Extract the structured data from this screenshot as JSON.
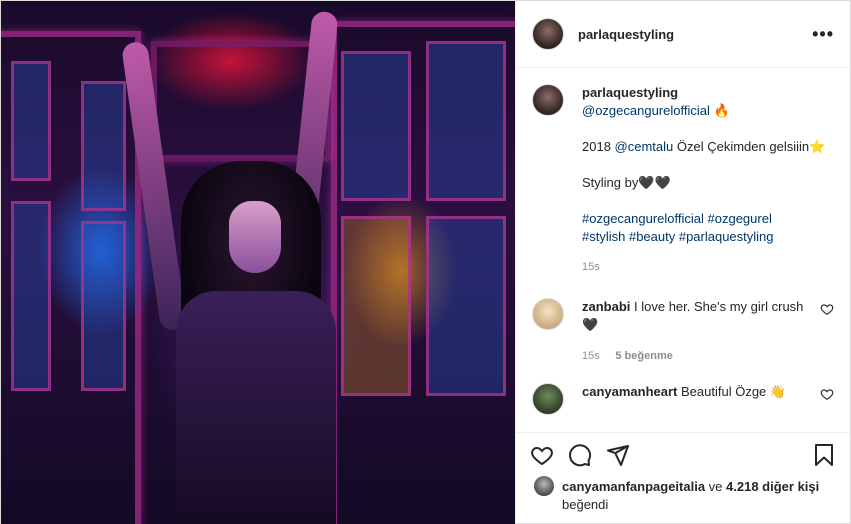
{
  "post": {
    "username": "parlaquestyling"
  },
  "caption": {
    "username": "parlaquestyling",
    "mention": "@ozgecangurelofficial",
    "flame": "🔥",
    "line2_year": "2018",
    "line2_mention": "@cemtalu",
    "line2_text": " Özel Çekimden gelsiiin⭐",
    "line3": "Styling by🖤🖤",
    "hashtags_line1": "#ozgecangurelofficial #ozgegurel",
    "hashtags_line2": "#stylish #beauty #parlaquestyling",
    "time": "15s"
  },
  "comments": [
    {
      "username": "zanbabi",
      "text": " I love her. She's my girl crush 🖤",
      "time": "15s",
      "likes": "5 beğenme"
    },
    {
      "username": "canyamanheart",
      "text": " Beautiful Özge 👋"
    }
  ],
  "liked_by": {
    "user": "canyamanfanpageitalia",
    "middle": " ve ",
    "others": "4.218 diğer kişi",
    "suffix": "beğendi"
  },
  "icons": {
    "more": "more-horizontal-icon",
    "like": "heart-icon",
    "comment": "comment-icon",
    "share": "send-icon",
    "save": "bookmark-icon"
  }
}
